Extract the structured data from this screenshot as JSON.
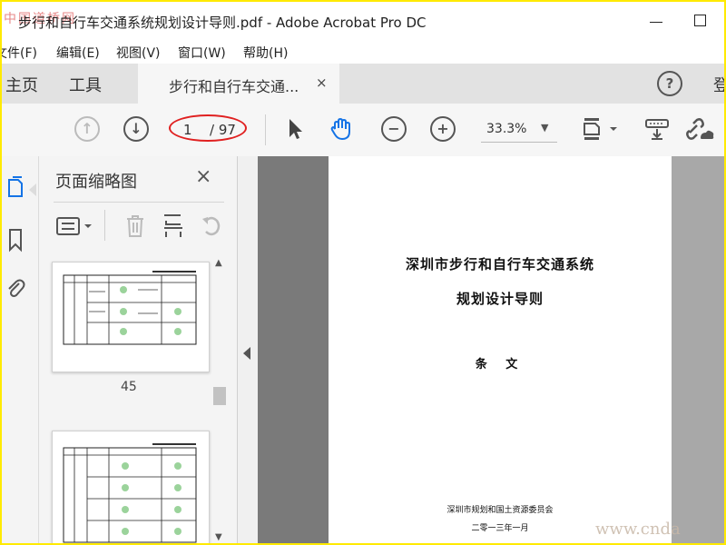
{
  "window": {
    "title": "步行和自行车交通系统规划设计导则.pdf - Adobe Acrobat Pro DC",
    "watermark_top": "中国道桥网",
    "watermark_bottom": "www.cnda"
  },
  "menu": [
    "文件(F)",
    "编辑(E)",
    "视图(V)",
    "窗口(W)",
    "帮助(H)"
  ],
  "tabs": {
    "home": "主页",
    "tools": "工具",
    "document": "步行和自行车交通...",
    "close": "×",
    "help": "?",
    "signin": "登"
  },
  "toolbar": {
    "page_current": "1",
    "page_total": "/ 97",
    "zoom": "33.3%"
  },
  "thumbnails": {
    "title": "页面缩略图",
    "close": "×",
    "page_labels": [
      "45"
    ]
  },
  "document": {
    "title_line1": "深圳市步行和自行车交通系统",
    "title_line2": "规划设计导则",
    "subtitle": "条 文",
    "organization": "深圳市规划和国土资源委员会",
    "date": "二零一三年一月"
  },
  "colors": {
    "highlight_oval": "#e02020",
    "frame_border": "#ffea00"
  }
}
